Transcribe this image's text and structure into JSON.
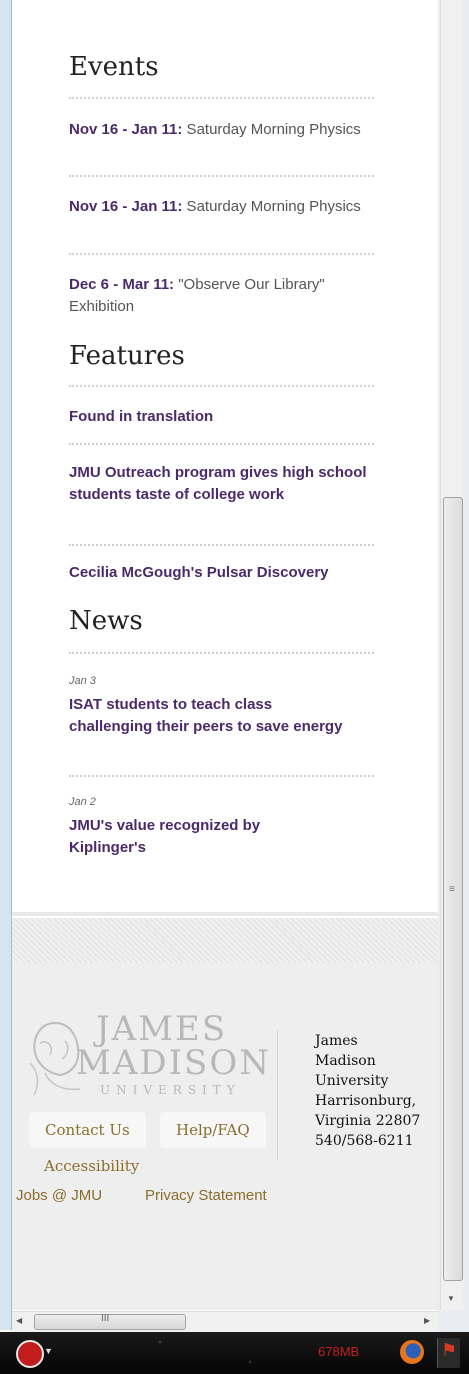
{
  "events": {
    "heading": "Events",
    "items": [
      {
        "date": "Nov 16 - Jan 11:",
        "title": " Saturday Morning Physics"
      },
      {
        "date": "Nov 16 - Jan 11:",
        "title": " Saturday Morning Physics"
      },
      {
        "date": "Dec 6 - Mar 11:",
        "title": " \"Observe Our Library\" Exhibition"
      }
    ]
  },
  "features": {
    "heading": "Features",
    "items": [
      "Found in translation",
      "JMU Outreach program gives high school students taste of college work",
      "Cecilia McGough's Pulsar Discovery"
    ]
  },
  "news": {
    "heading": "News",
    "items": [
      {
        "date": "Jan 3",
        "title": "ISAT students to teach class challenging their peers to save energy"
      },
      {
        "date": "Jan 2",
        "title": "JMU's value recognized by Kiplinger's"
      }
    ]
  },
  "footer": {
    "logo": {
      "line1": "JAMES",
      "line2": "MADISON",
      "line3": "UNIVERSITY"
    },
    "address": [
      "James",
      "Madison",
      "University",
      "Harrisonburg,",
      "Virginia 22807",
      "540/568-6211"
    ],
    "links": {
      "contact": "Contact Us",
      "help": "Help/FAQ",
      "accessibility": "Accessibility",
      "jobs": "Jobs @ JMU",
      "privacy": "Privacy Statement"
    }
  },
  "scrollbar": {
    "grip": "≡",
    "hgrip": "III",
    "up": "▲",
    "down": "▼",
    "left": "◀",
    "right": "▶"
  },
  "taskbar": {
    "memory": "678MB",
    "caret": "▼",
    "flag": "⚑"
  },
  "colors": {
    "link_purple": "#4b2a6b",
    "footer_gold": "#8a6d2c",
    "footer_bg": "#eeeeee"
  }
}
